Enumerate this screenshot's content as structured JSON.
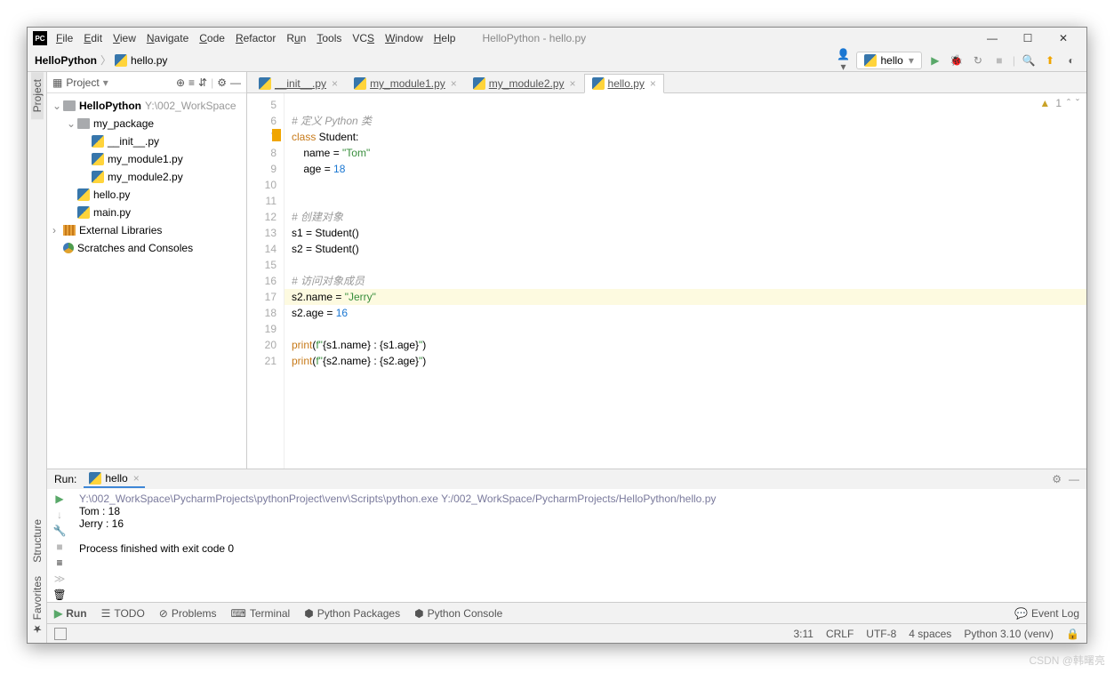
{
  "window": {
    "title": "HelloPython - hello.py"
  },
  "menu": [
    "File",
    "Edit",
    "View",
    "Navigate",
    "Code",
    "Refactor",
    "Run",
    "Tools",
    "VCS",
    "Window",
    "Help"
  ],
  "breadcrumb": {
    "root": "HelloPython",
    "file": "hello.py"
  },
  "runConfig": "hello",
  "project": {
    "panelTitle": "Project",
    "root": {
      "name": "HelloPython",
      "path": "Y:\\002_WorkSpace"
    },
    "pkg": "my_package",
    "files_pkg": [
      "__init__.py",
      "my_module1.py",
      "my_module2.py"
    ],
    "files_root": [
      "hello.py",
      "main.py"
    ],
    "external": "External Libraries",
    "scratches": "Scratches and Consoles"
  },
  "tabs": [
    {
      "label": "__init__.py"
    },
    {
      "label": "my_module1.py"
    },
    {
      "label": "my_module2.py"
    },
    {
      "label": "hello.py",
      "active": true
    }
  ],
  "inspection": {
    "warnings": "1"
  },
  "code": {
    "start": 5,
    "l5": "",
    "l6": "    # 定义 Python 类",
    "l7": "    class Student:",
    "l8": "        name = \"Tom\"",
    "l9": "        age = 18",
    "l10": "",
    "l11": "",
    "l12": "    # 创建对象",
    "l13": "    s1 = Student()",
    "l14": "    s2 = Student()",
    "l15": "",
    "l16": "    # 访问对象成员",
    "l17": "    s2.name = \"Jerry\"",
    "l18": "    s2.age = 16",
    "l19": "",
    "l20": "    print(f\"{s1.name} : {s1.age}\")",
    "l21": "    print(f\"{s2.name} : {s2.age}\")"
  },
  "run": {
    "label": "Run:",
    "tab": "hello",
    "cmd": "Y:\\002_WorkSpace\\PycharmProjects\\pythonProject\\venv\\Scripts\\python.exe Y:/002_WorkSpace/PycharmProjects/HelloPython/hello.py",
    "out1": "Tom : 18",
    "out2": "Jerry : 16",
    "exit": "Process finished with exit code 0"
  },
  "bottomTools": {
    "run": "Run",
    "todo": "TODO",
    "problems": "Problems",
    "terminal": "Terminal",
    "pypkg": "Python Packages",
    "pyconsole": "Python Console",
    "eventlog": "Event Log"
  },
  "status": {
    "pos": "3:11",
    "sep": "CRLF",
    "enc": "UTF-8",
    "indent": "4 spaces",
    "sdk": "Python 3.10 (venv)"
  },
  "rails": {
    "project": "Project",
    "structure": "Structure",
    "favorites": "Favorites"
  },
  "watermark": "CSDN @韩曙亮"
}
